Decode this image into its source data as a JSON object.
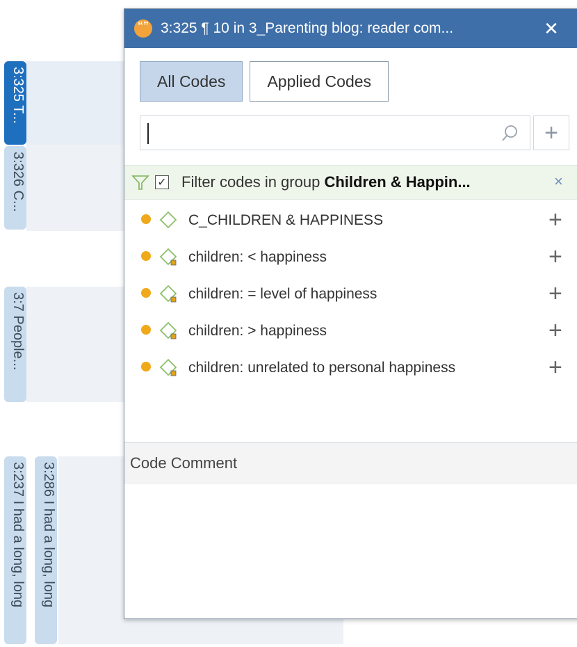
{
  "margin_tabs": [
    {
      "label": "3:325 T..."
    },
    {
      "label": "3:326 C..."
    },
    {
      "label": "3:7 People..."
    },
    {
      "label": "3:237 I had a long, long"
    },
    {
      "label": "3:286 I had a long, long"
    }
  ],
  "popup": {
    "title": "3:325 ¶ 10 in 3_Parenting blog: reader com...",
    "close_symbol": "✕",
    "tabs": {
      "all_codes": "All Codes",
      "applied_codes": "Applied Codes"
    },
    "search": {
      "value": "",
      "placeholder": ""
    },
    "add_symbol": "+",
    "filter": {
      "checked_symbol": "✓",
      "text": "Filter codes in group ",
      "group_name": "Children & Happin...",
      "close_symbol": "×"
    },
    "codes": [
      {
        "label": "C_CHILDREN & HAPPINESS",
        "icon": "code-group-diamond-icon"
      },
      {
        "label": "children: < happiness",
        "icon": "code-diamond-icon"
      },
      {
        "label": "children: = level of happiness",
        "icon": "code-diamond-icon"
      },
      {
        "label": "children: > happiness",
        "icon": "code-diamond-icon"
      },
      {
        "label": "children: unrelated to personal happiness",
        "icon": "code-diamond-icon"
      }
    ],
    "add_code_symbol": "+",
    "comment_header": "Code Comment"
  },
  "colors": {
    "titlebar": "#3f6fa8",
    "active_tab": "#1f6fbf",
    "inactive_tab": "#c9dced",
    "code_dot": "#f0a91b",
    "code_diamond": "#8cc068",
    "filter_bar": "#eef5ea"
  }
}
